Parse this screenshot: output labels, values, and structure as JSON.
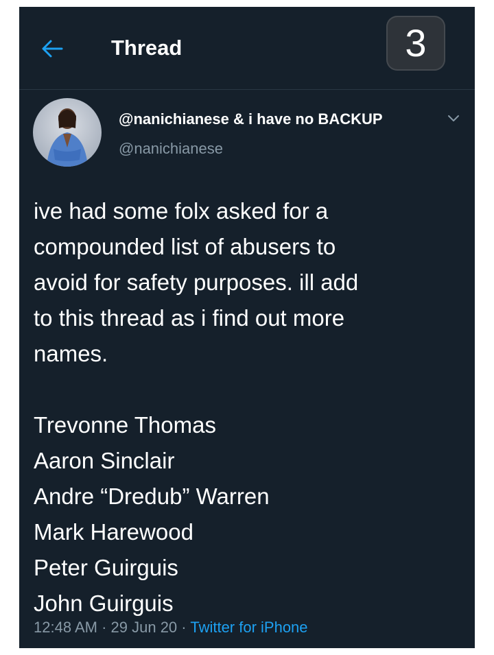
{
  "header": {
    "title": "Thread",
    "page_indicator": "3"
  },
  "author": {
    "display_name": "@nanichianese & i have no BACKUP",
    "handle": "@nanichianese"
  },
  "tweet": {
    "intro_lines": [
      "ive had some folx asked for a",
      "compounded list of abusers to",
      "avoid for safety purposes. ill add",
      "to this thread as i find out more",
      "names."
    ],
    "names": [
      "Trevonne Thomas",
      "Aaron Sinclair",
      "Andre “Dredub” Warren",
      "Mark Harewood",
      "Peter Guirguis",
      "John Guirguis"
    ]
  },
  "meta": {
    "time": "12:48 AM",
    "date": "29 Jun 20",
    "separator": "·",
    "source": "Twitter for iPhone"
  },
  "colors": {
    "background": "#15202b",
    "accent": "#1da1f2",
    "muted": "#8899a6",
    "text": "#ffffff"
  },
  "icons": {
    "back": "back-arrow-icon",
    "more": "chevron-down-icon"
  }
}
